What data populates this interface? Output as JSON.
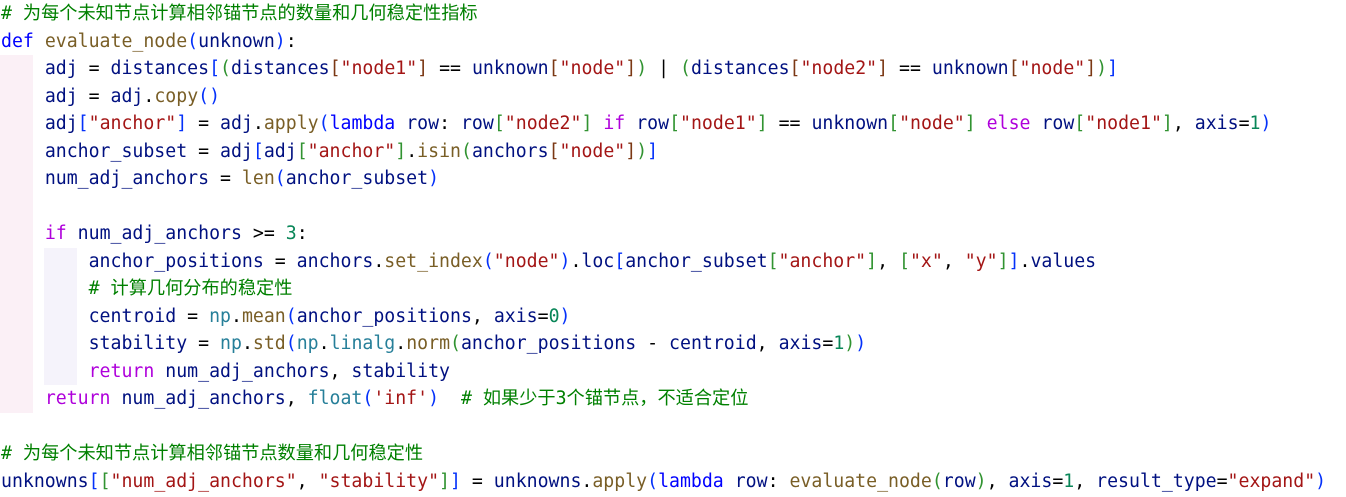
{
  "background": "#ffffff",
  "indent_guide_colors": [
    "#fbf0f6",
    "#f5f3fb"
  ],
  "syntax_colors": {
    "c": "#008000",
    "k": "#0000ff",
    "f": "#af00db",
    "fn": "#795e26",
    "v": "#001080",
    "s": "#a31515",
    "n": "#098658",
    "m": "#267f99",
    "o": "#000000",
    "b1": "#0431fa",
    "b2": "#319331",
    "b3": "#7b3814"
  },
  "editor": {
    "lines": [
      [
        {
          "c": "# 为每个未知节点计算相邻锚节点的数量和几何稳定性指标"
        }
      ],
      [
        {
          "k": "def"
        },
        {
          "o": " "
        },
        {
          "fn": "evaluate_node"
        },
        {
          "b1": "("
        },
        {
          "v": "unknown"
        },
        {
          "b1": ")"
        },
        {
          "o": ":"
        }
      ],
      [
        {
          "o": "    "
        },
        {
          "v": "adj"
        },
        {
          "o": " = "
        },
        {
          "v": "distances"
        },
        {
          "b1": "["
        },
        {
          "b2": "("
        },
        {
          "v": "distances"
        },
        {
          "b3": "["
        },
        {
          "s": "\"node1\""
        },
        {
          "b3": "]"
        },
        {
          "o": " == "
        },
        {
          "v": "unknown"
        },
        {
          "b3": "["
        },
        {
          "s": "\"node\""
        },
        {
          "b3": "]"
        },
        {
          "b2": ")"
        },
        {
          "o": " | "
        },
        {
          "b2": "("
        },
        {
          "v": "distances"
        },
        {
          "b3": "["
        },
        {
          "s": "\"node2\""
        },
        {
          "b3": "]"
        },
        {
          "o": " == "
        },
        {
          "v": "unknown"
        },
        {
          "b3": "["
        },
        {
          "s": "\"node\""
        },
        {
          "b3": "]"
        },
        {
          "b2": ")"
        },
        {
          "b1": "]"
        }
      ],
      [
        {
          "o": "    "
        },
        {
          "v": "adj"
        },
        {
          "o": " = "
        },
        {
          "v": "adj"
        },
        {
          "o": "."
        },
        {
          "fn": "copy"
        },
        {
          "b1": "("
        },
        {
          "b1": ")"
        }
      ],
      [
        {
          "o": "    "
        },
        {
          "v": "adj"
        },
        {
          "b1": "["
        },
        {
          "s": "\"anchor\""
        },
        {
          "b1": "]"
        },
        {
          "o": " = "
        },
        {
          "v": "adj"
        },
        {
          "o": "."
        },
        {
          "fn": "apply"
        },
        {
          "b1": "("
        },
        {
          "k": "lambda"
        },
        {
          "o": " "
        },
        {
          "v": "row"
        },
        {
          "o": ": "
        },
        {
          "v": "row"
        },
        {
          "b2": "["
        },
        {
          "s": "\"node2\""
        },
        {
          "b2": "]"
        },
        {
          "o": " "
        },
        {
          "f": "if"
        },
        {
          "o": " "
        },
        {
          "v": "row"
        },
        {
          "b2": "["
        },
        {
          "s": "\"node1\""
        },
        {
          "b2": "]"
        },
        {
          "o": " == "
        },
        {
          "v": "unknown"
        },
        {
          "b2": "["
        },
        {
          "s": "\"node\""
        },
        {
          "b2": "]"
        },
        {
          "o": " "
        },
        {
          "f": "else"
        },
        {
          "o": " "
        },
        {
          "v": "row"
        },
        {
          "b2": "["
        },
        {
          "s": "\"node1\""
        },
        {
          "b2": "]"
        },
        {
          "o": ", "
        },
        {
          "v": "axis"
        },
        {
          "o": "="
        },
        {
          "n": "1"
        },
        {
          "b1": ")"
        }
      ],
      [
        {
          "o": "    "
        },
        {
          "v": "anchor_subset"
        },
        {
          "o": " = "
        },
        {
          "v": "adj"
        },
        {
          "b1": "["
        },
        {
          "v": "adj"
        },
        {
          "b2": "["
        },
        {
          "s": "\"anchor\""
        },
        {
          "b2": "]"
        },
        {
          "o": "."
        },
        {
          "fn": "isin"
        },
        {
          "b2": "("
        },
        {
          "v": "anchors"
        },
        {
          "b3": "["
        },
        {
          "s": "\"node\""
        },
        {
          "b3": "]"
        },
        {
          "b2": ")"
        },
        {
          "b1": "]"
        }
      ],
      [
        {
          "o": "    "
        },
        {
          "v": "num_adj_anchors"
        },
        {
          "o": " = "
        },
        {
          "fn": "len"
        },
        {
          "b1": "("
        },
        {
          "v": "anchor_subset"
        },
        {
          "b1": ")"
        }
      ],
      [],
      [
        {
          "o": "    "
        },
        {
          "f": "if"
        },
        {
          "o": " "
        },
        {
          "v": "num_adj_anchors"
        },
        {
          "o": " >= "
        },
        {
          "n": "3"
        },
        {
          "o": ":"
        }
      ],
      [
        {
          "o": "        "
        },
        {
          "v": "anchor_positions"
        },
        {
          "o": " = "
        },
        {
          "v": "anchors"
        },
        {
          "o": "."
        },
        {
          "fn": "set_index"
        },
        {
          "b1": "("
        },
        {
          "s": "\"node\""
        },
        {
          "b1": ")"
        },
        {
          "o": "."
        },
        {
          "v": "loc"
        },
        {
          "b1": "["
        },
        {
          "v": "anchor_subset"
        },
        {
          "b2": "["
        },
        {
          "s": "\"anchor\""
        },
        {
          "b2": "]"
        },
        {
          "o": ", "
        },
        {
          "b2": "["
        },
        {
          "s": "\"x\""
        },
        {
          "o": ", "
        },
        {
          "s": "\"y\""
        },
        {
          "b2": "]"
        },
        {
          "b1": "]"
        },
        {
          "o": "."
        },
        {
          "v": "values"
        }
      ],
      [
        {
          "o": "        "
        },
        {
          "c": "# 计算几何分布的稳定性"
        }
      ],
      [
        {
          "o": "        "
        },
        {
          "v": "centroid"
        },
        {
          "o": " = "
        },
        {
          "m": "np"
        },
        {
          "o": "."
        },
        {
          "fn": "mean"
        },
        {
          "b1": "("
        },
        {
          "v": "anchor_positions"
        },
        {
          "o": ", "
        },
        {
          "v": "axis"
        },
        {
          "o": "="
        },
        {
          "n": "0"
        },
        {
          "b1": ")"
        }
      ],
      [
        {
          "o": "        "
        },
        {
          "v": "stability"
        },
        {
          "o": " = "
        },
        {
          "m": "np"
        },
        {
          "o": "."
        },
        {
          "fn": "std"
        },
        {
          "b1": "("
        },
        {
          "m": "np"
        },
        {
          "o": "."
        },
        {
          "m": "linalg"
        },
        {
          "o": "."
        },
        {
          "fn": "norm"
        },
        {
          "b2": "("
        },
        {
          "v": "anchor_positions"
        },
        {
          "o": " - "
        },
        {
          "v": "centroid"
        },
        {
          "o": ", "
        },
        {
          "v": "axis"
        },
        {
          "o": "="
        },
        {
          "n": "1"
        },
        {
          "b2": ")"
        },
        {
          "b1": ")"
        }
      ],
      [
        {
          "o": "        "
        },
        {
          "f": "return"
        },
        {
          "o": " "
        },
        {
          "v": "num_adj_anchors"
        },
        {
          "o": ", "
        },
        {
          "v": "stability"
        }
      ],
      [
        {
          "o": "    "
        },
        {
          "f": "return"
        },
        {
          "o": " "
        },
        {
          "v": "num_adj_anchors"
        },
        {
          "o": ", "
        },
        {
          "m": "float"
        },
        {
          "b1": "("
        },
        {
          "s": "'inf'"
        },
        {
          "b1": ")"
        },
        {
          "o": "  "
        },
        {
          "c": "# 如果少于3个锚节点，不适合定位"
        }
      ],
      [],
      [
        {
          "c": "# 为每个未知节点计算相邻锚节点数量和几何稳定性"
        }
      ],
      [
        {
          "v": "unknowns"
        },
        {
          "b1": "["
        },
        {
          "b2": "["
        },
        {
          "s": "\"num_adj_anchors\""
        },
        {
          "o": ", "
        },
        {
          "s": "\"stability\""
        },
        {
          "b2": "]"
        },
        {
          "b1": "]"
        },
        {
          "o": " = "
        },
        {
          "v": "unknowns"
        },
        {
          "o": "."
        },
        {
          "fn": "apply"
        },
        {
          "b1": "("
        },
        {
          "k": "lambda"
        },
        {
          "o": " "
        },
        {
          "v": "row"
        },
        {
          "o": ": "
        },
        {
          "fn": "evaluate_node"
        },
        {
          "b2": "("
        },
        {
          "v": "row"
        },
        {
          "b2": ")"
        },
        {
          "o": ", "
        },
        {
          "v": "axis"
        },
        {
          "o": "="
        },
        {
          "n": "1"
        },
        {
          "o": ", "
        },
        {
          "v": "result_type"
        },
        {
          "o": "="
        },
        {
          "s": "\"expand\""
        },
        {
          "b1": ")"
        }
      ]
    ]
  }
}
